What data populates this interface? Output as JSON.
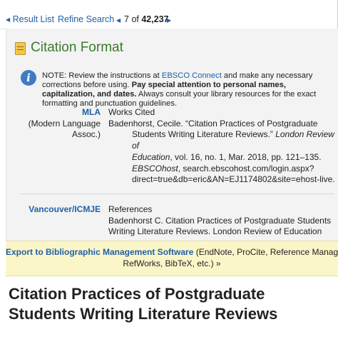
{
  "nav": {
    "result_list": "Result List",
    "refine_search": "Refine Search",
    "position_current": "7",
    "position_of": "of",
    "position_total": "42,237"
  },
  "citation_format": {
    "title": "Citation Format",
    "note": {
      "prefix": "NOTE: Review the instructions at ",
      "link": "EBSCO Connect",
      "middle": " and make any necessary corrections before using. ",
      "bold": "Pay special attention to personal names, capitalization, and dates.",
      "suffix": " Always consult your library resources for the exact formatting and punctuation guidelines."
    },
    "mla": {
      "label": "MLA",
      "sublabel_1": "(Modern Language",
      "sublabel_2": "Assoc.)",
      "header": "Works Cited",
      "line1": "Badenhorst, Cecile. “Citation Practices of Postgraduate",
      "line2": "Students Writing Literature Reviews.”",
      "line2_italic": "London Review of",
      "line3_italic": "Education",
      "line3": ", vol. 16, no. 1, Mar. 2018, pp. 121–135.",
      "line4_italic": "EBSCOhost",
      "line4": ", search.ebscohost.com/login.aspx?",
      "line5": "direct=true&db=eric&AN=EJ1174802&site=ehost-live."
    },
    "vancouver": {
      "label": "Vancouver/ICMJE",
      "header": "References",
      "line1": "Badenhorst C. Citation Practices of Postgraduate Students",
      "line2": "Writing Literature Reviews. London Review of Education"
    },
    "export": {
      "link": "Export to Bibliographic Management Software",
      "line1_rest": " (EndNote, ProCite, Reference Manager,",
      "line2": "RefWorks, BibTeX, etc.) »"
    }
  },
  "article": {
    "title": "Citation Practices of Postgraduate Students Writing Literature Reviews"
  },
  "colors": {
    "link": "#1f5fa8",
    "title_green": "#3c7a2e",
    "panel_bg": "#f3f3f3",
    "export_bg": "#fbf6c8",
    "info_blue": "#3e7bc4"
  }
}
